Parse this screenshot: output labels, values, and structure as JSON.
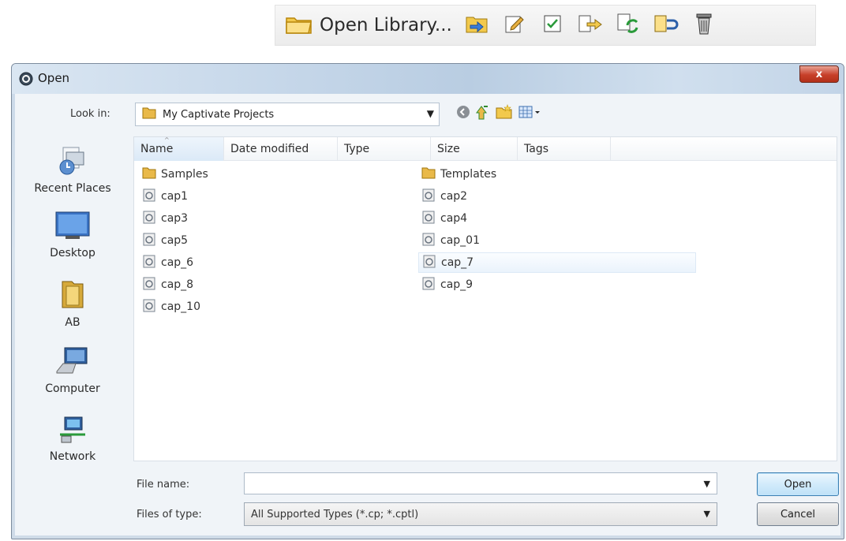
{
  "toolbar": {
    "open_library_label": "Open Library...",
    "buttons": [
      {
        "icon": "import-folder-icon"
      },
      {
        "icon": "edit-properties-icon"
      },
      {
        "icon": "select-unused-icon"
      },
      {
        "icon": "export-icon"
      },
      {
        "icon": "update-icon"
      },
      {
        "icon": "rename-icon"
      },
      {
        "icon": "delete-icon"
      }
    ]
  },
  "dialog": {
    "title": "Open",
    "close_glyph": "x",
    "look_in_label": "Look in:",
    "look_in_value": "My Captivate Projects",
    "places": [
      {
        "label": "Recent Places",
        "icon": "recent-places-icon"
      },
      {
        "label": "Desktop",
        "icon": "desktop-icon"
      },
      {
        "label": "AB",
        "icon": "user-folder-icon"
      },
      {
        "label": "Computer",
        "icon": "computer-icon"
      },
      {
        "label": "Network",
        "icon": "network-icon"
      }
    ],
    "columns": [
      "Name",
      "Date modified",
      "Type",
      "Size",
      "Tags"
    ],
    "files_left": [
      {
        "name": "Samples",
        "kind": "folder"
      },
      {
        "name": "cap1",
        "kind": "file"
      },
      {
        "name": "cap3",
        "kind": "file"
      },
      {
        "name": "cap5",
        "kind": "file"
      },
      {
        "name": "cap_6",
        "kind": "file"
      },
      {
        "name": "cap_8",
        "kind": "file"
      },
      {
        "name": "cap_10",
        "kind": "file"
      }
    ],
    "files_right": [
      {
        "name": "Templates",
        "kind": "folder"
      },
      {
        "name": "cap2",
        "kind": "file"
      },
      {
        "name": "cap4",
        "kind": "file"
      },
      {
        "name": "cap_01",
        "kind": "file"
      },
      {
        "name": "cap_7",
        "kind": "file"
      },
      {
        "name": "cap_9",
        "kind": "file"
      }
    ],
    "file_name_label": "File name:",
    "file_name_value": "",
    "files_of_type_label": "Files of type:",
    "files_of_type_value": "All Supported Types (*.cp; *.cptl)",
    "open_button": "Open",
    "cancel_button": "Cancel"
  }
}
